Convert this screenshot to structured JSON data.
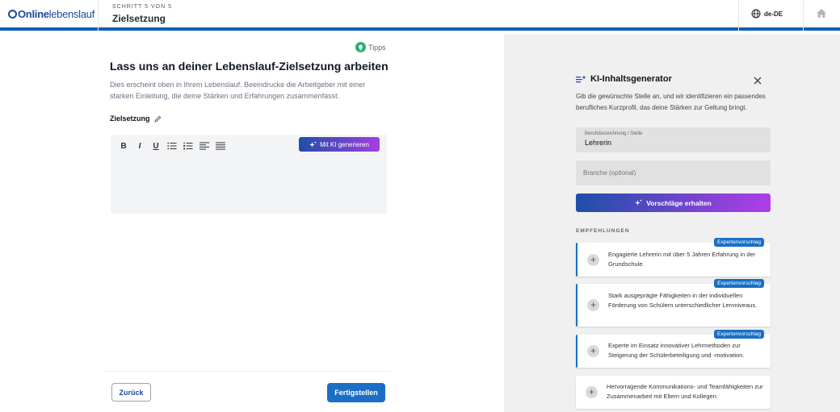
{
  "header": {
    "logo_bold": "Online",
    "logo_light": "lebenslauf",
    "step_label": "SCHRITT 5 VON 5",
    "step_title": "Zielsetzung",
    "language": "de-DE"
  },
  "left": {
    "tipps_label": "Tipps",
    "title": "Lass uns an deiner Lebenslauf-Zielsetzung arbeiten",
    "description": "Dies erscheint oben in Ihrem Lebenslauf. Beeindrucke die Arbeitgeber mit einer starken Einleitung, die deine Stärken und Erfahrungen zusammenfasst.",
    "field_label": "Zielsetzung",
    "toolbar": {
      "bold": "B",
      "italic": "I",
      "underline": "U",
      "ai_button": "Mit KI generieren"
    },
    "back_button": "Zurück",
    "finish_button": "Fertigstellen"
  },
  "generator": {
    "title": "KI-Inhaltsgenerator",
    "description": "Gib die gewünschte Stelle an, und wir identifizieren ein passendes berufliches Kurzprofil, das deine Stärken zur Geltung bringt.",
    "job_label": "Berufsbezeichnung / Stelle",
    "job_value": "Lehrerin",
    "industry_placeholder": "Branche (optional)",
    "suggest_button": "Vorschläge erhalten",
    "recommendations_header": "EMPFEHLUNGEN",
    "cards": [
      {
        "text": "Engagierte Lehrerin mit über 5 Jahren Erfahrung in der Grundschule.",
        "badge": "Expertenvorschlag"
      },
      {
        "text": "Stark ausgeprägte Fähigkeiten in der individuellen Förderung von Schülern unterschiedlicher Lernniveaus.",
        "badge": "Expertenvorschlag"
      },
      {
        "text": "Experte im Einsatz innovativer Lehrmethoden zur Steigerung der Schülerbeteiligung und -motivation.",
        "badge": "Expertenvorschlag"
      },
      {
        "text": "Hervorragende Kommunikations- und Teamfähigkeiten zur Zusammenarbeit mit Eltern und Kollegen.",
        "badge": ""
      }
    ]
  },
  "colors": {
    "brand_blue": "#1c4a9c",
    "accent_blue": "#1a6fc4",
    "ai_gradient_end": "#b03de8",
    "tipps_green": "#26b36b"
  }
}
